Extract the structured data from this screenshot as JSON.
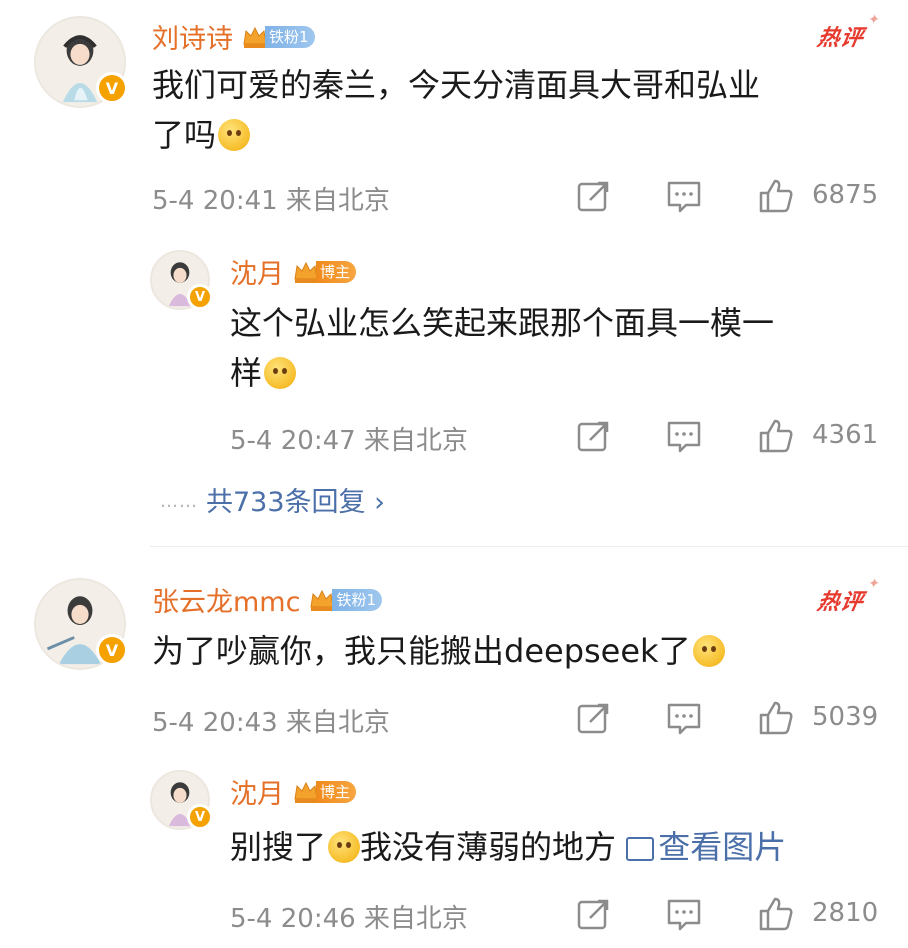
{
  "comments": [
    {
      "username": "刘诗诗",
      "fan_badge": "铁粉1",
      "hot_label": "热评",
      "text_line1": "我们可爱的秦兰，今天分清面具大哥和弘业",
      "text_line2": "了吗",
      "emoji": "thinking-face",
      "meta": "5-4 20:41  来自北京",
      "likes": "6875",
      "reply": {
        "username": "沈月",
        "badge": "博主",
        "text_line1": "这个弘业怎么笑起来跟那个面具一模一",
        "text_line2": "样",
        "emoji": "flushed-face",
        "meta": "5-4 20:47  来自北京",
        "likes": "4361"
      },
      "more_dots": "……",
      "more_replies": "共733条回复 ›"
    },
    {
      "username": "张云龙mmc",
      "fan_badge": "铁粉1",
      "hot_label": "热评",
      "text_line1": "为了吵赢你，我只能搬出deepseek了",
      "emoji": "thinking-face",
      "meta": "5-4 20:43  来自北京",
      "likes": "5039",
      "reply": {
        "username": "沈月",
        "badge": "博主",
        "text_before": "别搜了",
        "emoji": "smiling-face",
        "text_after": "我没有薄弱的地方",
        "image_link": "查看图片",
        "meta": "5-4 20:46  来自北京",
        "likes": "2810"
      }
    }
  ],
  "icons": {
    "verified": "V",
    "share": "share-icon",
    "comment": "comment-icon",
    "like": "like-icon"
  },
  "colors": {
    "username": "#e5702a",
    "hot": "#e63a2e",
    "link": "#4b6fa8",
    "meta": "#8c8c8c",
    "verified": "#f5a100"
  }
}
